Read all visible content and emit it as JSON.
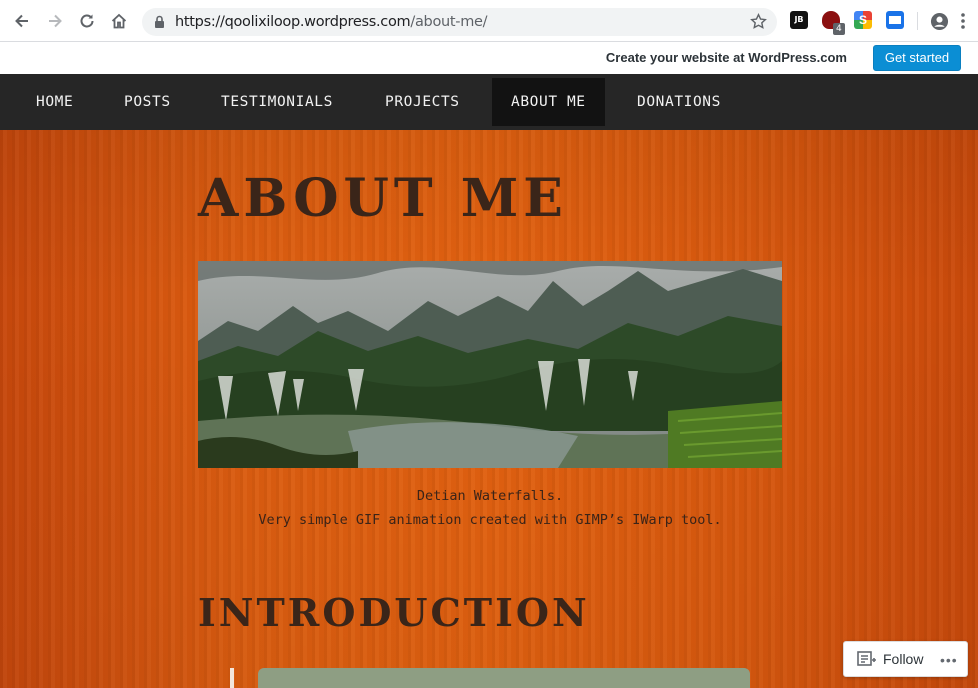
{
  "browser": {
    "url_host": "https://qoolixiloop.wordpress.com",
    "url_path": "/about-me/",
    "extensions": {
      "jetbrains": "JB",
      "shield_badge": "4",
      "s_ext": "S"
    }
  },
  "wp_banner": {
    "text": "Create your website at WordPress.com",
    "button": "Get started"
  },
  "nav": {
    "items": [
      {
        "label": "HOME"
      },
      {
        "label": "POSTS"
      },
      {
        "label": "TESTIMONIALS"
      },
      {
        "label": "PROJECTS"
      },
      {
        "label": "ABOUT ME",
        "active": true
      },
      {
        "label": "DONATIONS"
      }
    ]
  },
  "page": {
    "title": "ABOUT ME",
    "caption_line1": "Detian Waterfalls.",
    "caption_line2": "Very simple GIF animation created with GIMP’s IWarp tool.",
    "section_title": "INTRODUCTION"
  },
  "follow": {
    "label": "Follow",
    "more": "•••"
  },
  "colors": {
    "nav_bg": "#262626",
    "nav_active_bg": "#121212",
    "page_bg": "#de5e10",
    "heading": "#3a2519",
    "wp_button": "#0b8ed4"
  }
}
